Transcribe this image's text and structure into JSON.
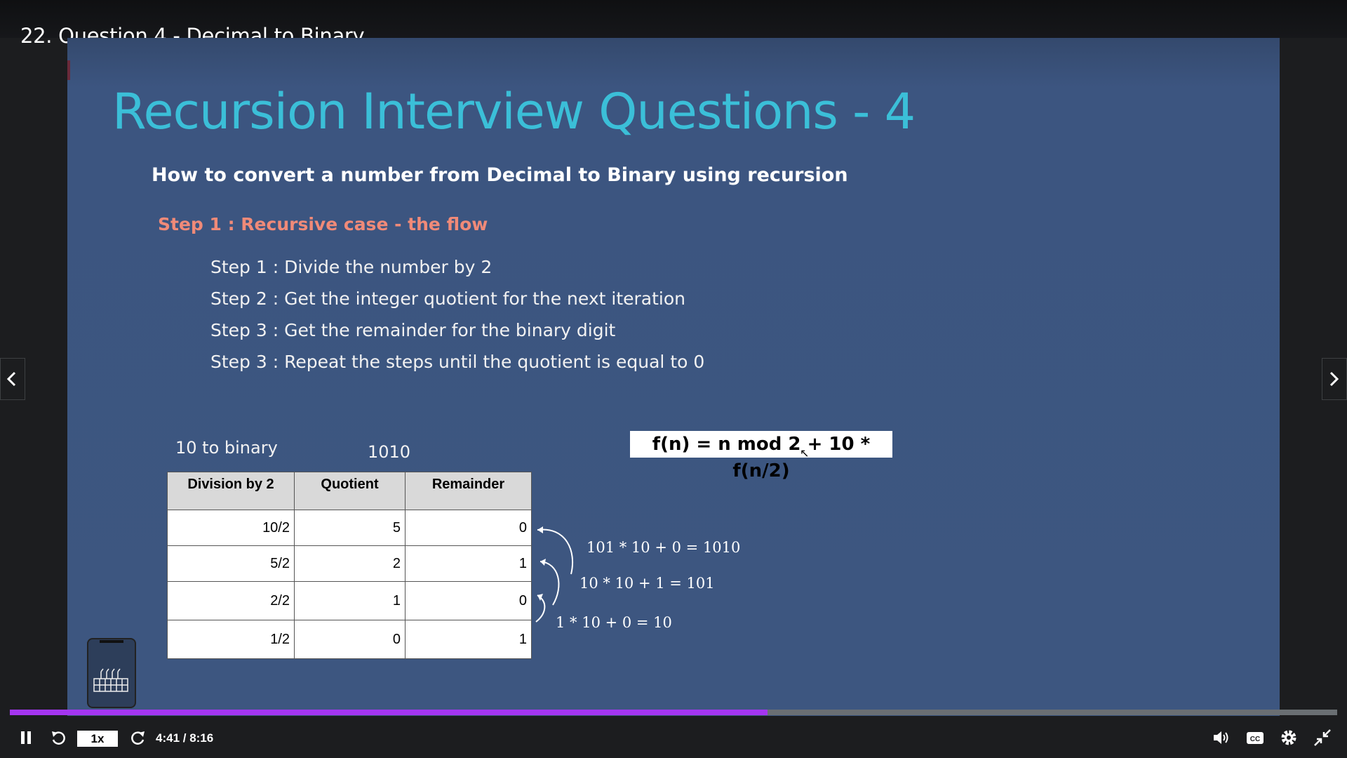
{
  "video": {
    "title": "22. Question 4 - Decimal to Binary"
  },
  "slide": {
    "title": "Recursion Interview Questions - 4",
    "subtitle": "How to convert a number from Decimal to Binary using recursion",
    "step_heading": "Step 1 : Recursive case - the flow",
    "steps": [
      "Step 1 : Divide the number by 2",
      "Step 2 : Get the integer quotient for the next iteration",
      "Step 3 : Get the remainder for the binary digit",
      "Step 3 : Repeat the steps until the quotient is equal to 0"
    ],
    "example_label": "10  to binary",
    "example_result": "1010",
    "formula": "f(n) = n mod 2 + 10 * f(n/2)",
    "table": {
      "headers": [
        "Division by 2",
        "Quotient",
        "Remainder"
      ],
      "rows": [
        [
          "10/2",
          "5",
          "0"
        ],
        [
          "5/2",
          "2",
          "1"
        ],
        [
          "2/2",
          "1",
          "0"
        ],
        [
          "1/2",
          "0",
          "1"
        ]
      ]
    },
    "calculations": [
      "101 * 10 + 0 = 1010",
      "10 * 10 + 1 = 101",
      "1 * 10 + 0 = 10"
    ]
  },
  "player": {
    "speed": "1x",
    "time": "4:41 / 8:16",
    "progress_fraction": 0.5706,
    "accent_color": "#a435f0",
    "icons": [
      "pause-icon",
      "rewind-icon",
      "forward-icon",
      "volume-icon",
      "captions-icon",
      "settings-icon",
      "exit-fullscreen-icon",
      "prev-lecture-icon",
      "next-lecture-icon"
    ]
  }
}
